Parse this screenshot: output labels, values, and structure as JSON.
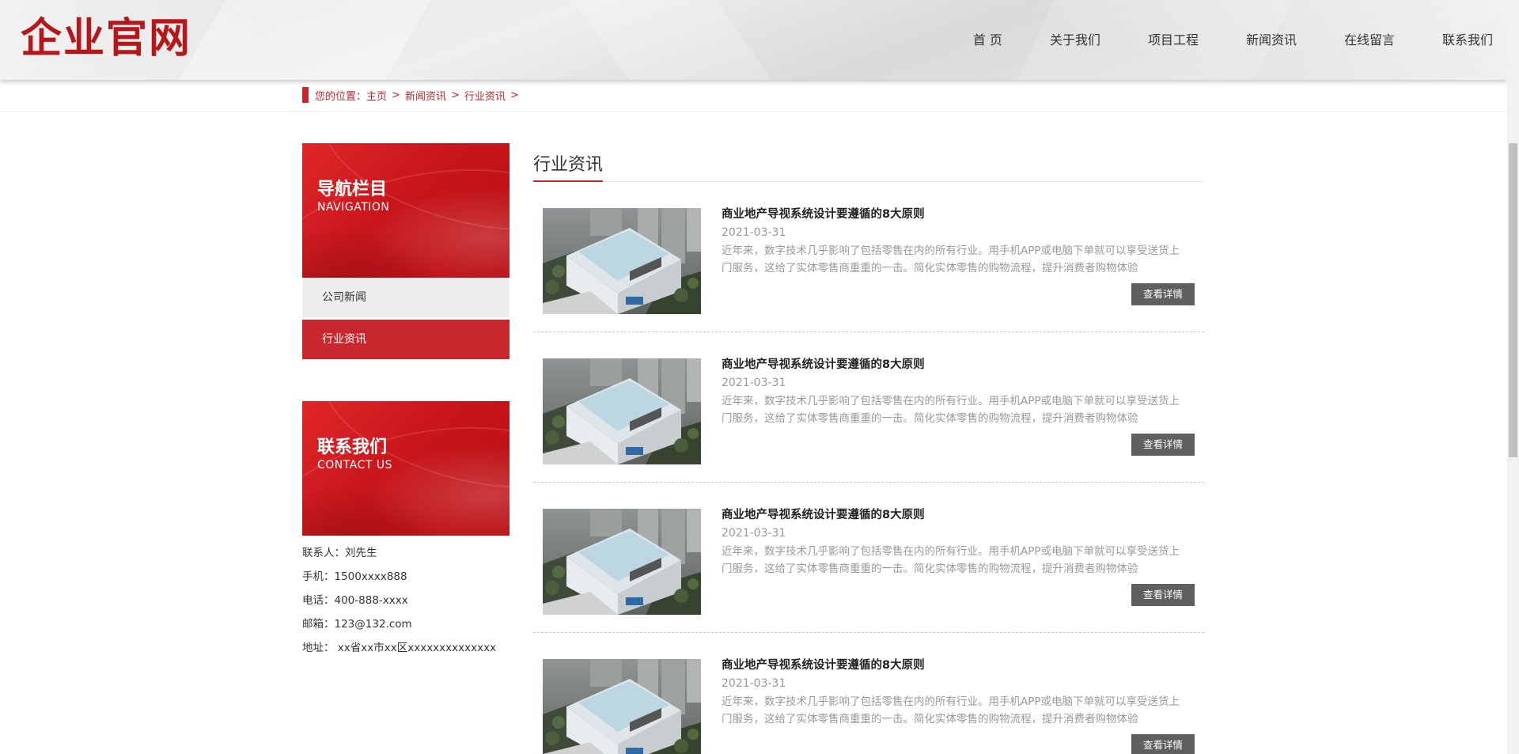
{
  "header": {
    "logo": "企业官网",
    "nav": [
      "首 页",
      "关于我们",
      "项目工程",
      "新闻资讯",
      "在线留言",
      "联系我们"
    ]
  },
  "breadcrumb": {
    "prefix": "您的位置：",
    "items": [
      "主页",
      "新闻资讯",
      "行业资讯"
    ],
    "separator": ">"
  },
  "sidebar": {
    "nav_banner": {
      "title": "导航栏目",
      "subtitle": "NAVIGATION"
    },
    "menu": [
      {
        "label": "公司新闻",
        "active": false
      },
      {
        "label": "行业资讯",
        "active": true
      }
    ],
    "contact_banner": {
      "title": "联系我们",
      "subtitle": "CONTACT US"
    },
    "contact": [
      "联系人：刘先生",
      "手机：1500xxxx888",
      "电话：400-888-xxxx",
      "邮箱：123@132.com",
      "地址： xx省xx市xx区xxxxxxxxxxxxxx"
    ]
  },
  "main": {
    "title": "行业资讯",
    "articles": [
      {
        "title": "商业地产导视系统设计要遵循的8大原则",
        "date": "2021-03-31",
        "summary": "近年来，数字技术几乎影响了包括零售在内的所有行业。用手机APP或电脑下单就可以享受送货上门服务，这给了实体零售商重重的一击。简化实体零售的购物流程，提升消费者购物体验",
        "button": "查看详情"
      },
      {
        "title": "商业地产导视系统设计要遵循的8大原则",
        "date": "2021-03-31",
        "summary": "近年来，数字技术几乎影响了包括零售在内的所有行业。用手机APP或电脑下单就可以享受送货上门服务，这给了实体零售商重重的一击。简化实体零售的购物流程，提升消费者购物体验",
        "button": "查看详情"
      },
      {
        "title": "商业地产导视系统设计要遵循的8大原则",
        "date": "2021-03-31",
        "summary": "近年来，数字技术几乎影响了包括零售在内的所有行业。用手机APP或电脑下单就可以享受送货上门服务，这给了实体零售商重重的一击。简化实体零售的购物流程，提升消费者购物体验",
        "button": "查看详情"
      },
      {
        "title": "商业地产导视系统设计要遵循的8大原则",
        "date": "2021-03-31",
        "summary": "近年来，数字技术几乎影响了包括零售在内的所有行业。用手机APP或电脑下单就可以享受送货上门服务，这给了实体零售商重重的一击。简化实体零售的购物流程，提升消费者购物体验",
        "button": "查看详情"
      }
    ]
  },
  "colors": {
    "brand_red": "#c8282d",
    "logo_red": "#b3191b",
    "button_gray": "#5f5f5f"
  }
}
